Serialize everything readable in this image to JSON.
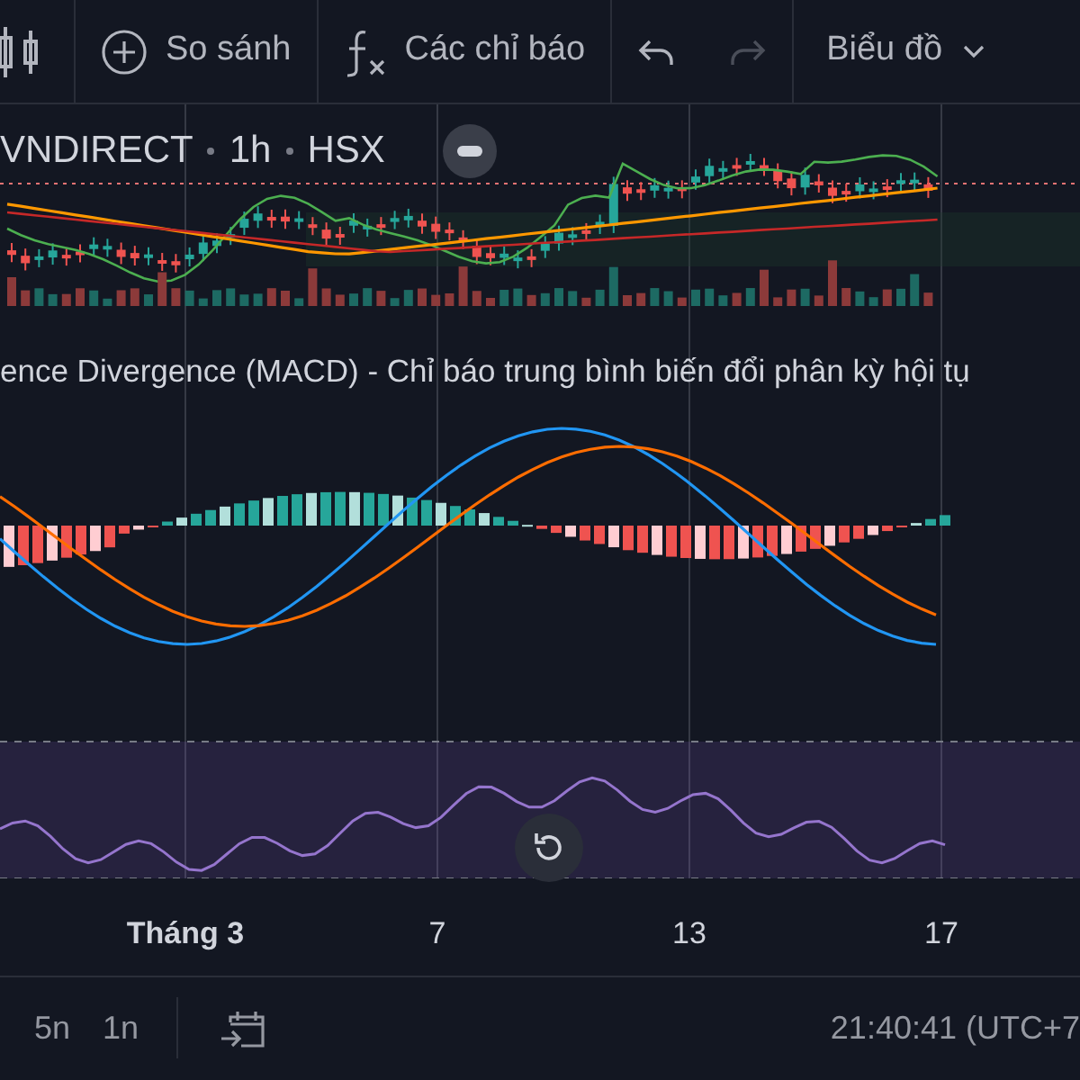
{
  "toolbar": {
    "compare": "So sánh",
    "indicators": "Các chỉ báo",
    "undo": {
      "disabled": false
    },
    "redo": {
      "disabled": true
    },
    "layout": "Biểu đồ"
  },
  "legend": [
    "VNDIRECT",
    "1h",
    "HSX"
  ],
  "macd_title": "ence Divergence (MACD) - Chỉ báo trung bình biến đổi phân kỳ hội tụ",
  "x_axis": [
    {
      "label": "Tháng 3",
      "emphasized": true
    },
    {
      "label": "7",
      "emphasized": false
    },
    {
      "label": "13",
      "emphasized": false
    },
    {
      "label": "17",
      "emphasized": false
    }
  ],
  "ranges": [
    "5n",
    "1n"
  ],
  "clock": "21:40:41 (UTC+7"
}
